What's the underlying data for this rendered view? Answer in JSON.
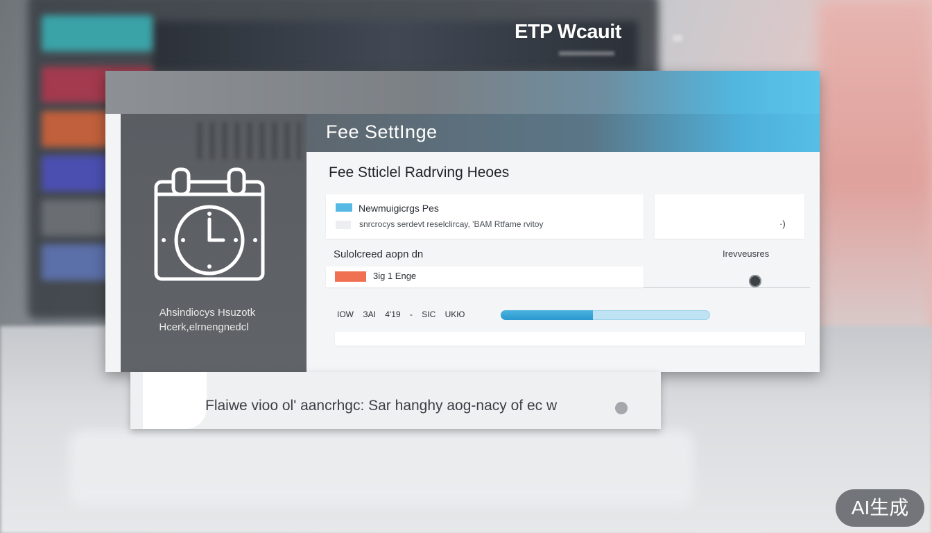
{
  "brand": {
    "name": "ETP Wcauit"
  },
  "header": {
    "title": "Fee SettIngе"
  },
  "sidebar": {
    "icon": "calendar-clock-icon",
    "caption_line1": "Ahsindiocys Hsuzotk",
    "caption_line2": "Hcerk,elrnengnedcl"
  },
  "main": {
    "section_title": "Fee Stticlel Radrving Heoes",
    "row1": {
      "label": "Newmuigicrgs Pes",
      "description": "snrcrocys serdevt reselclircay, 'BAM Rtfame rvitoy",
      "swatch_color": "#55b9e3"
    },
    "card_b_mark": "·)",
    "sub_label": "Sulolcreed aopn dn",
    "right_label": "Irevveusres",
    "row2": {
      "label": "3ig 1 Engе",
      "swatch_color": "#f07152"
    },
    "slider": {
      "value_fraction": 0.62
    },
    "stats": {
      "text": "IOW ЗAI 4'19 - SIC UKЮ"
    },
    "progress": {
      "value_percent": 44
    }
  },
  "secondary_panel": {
    "text": "Flaiwe vioo ol' aancrhgc: Sar hanghy aog-nacy of ec w"
  },
  "watermark": {
    "text": "AI生成"
  },
  "colors": {
    "accent_blue": "#52b6de",
    "accent_orange": "#f07152",
    "sidebar_grey": "#5a5e63"
  }
}
